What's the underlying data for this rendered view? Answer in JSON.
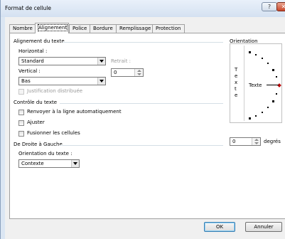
{
  "window": {
    "title": "Format de cellule",
    "help_glyph": "?",
    "close_glyph": "✕"
  },
  "tabs": [
    {
      "label": "Nombre"
    },
    {
      "label": "Alignement"
    },
    {
      "label": "Police"
    },
    {
      "label": "Bordure"
    },
    {
      "label": "Remplissage"
    },
    {
      "label": "Protection"
    }
  ],
  "active_tab": "Alignement",
  "text_alignment": {
    "group_label": "Alignement du texte",
    "horizontal_label": "Horizontal :",
    "horizontal_value": "Standard",
    "vertical_label": "Vertical :",
    "vertical_value": "Bas",
    "indent_label": "Retrait :",
    "indent_value": "0",
    "justify_distributed_label": "Justification distribuée"
  },
  "text_control": {
    "group_label": "Contrôle du texte",
    "wrap_label": "Renvoyer à la ligne automatiquement",
    "shrink_label": "Ajuster",
    "merge_label": "Fusionner les cellules"
  },
  "rtl": {
    "group_label": "De Droite à Gauche",
    "direction_label": "Orientation du texte :",
    "direction_value": "Contexte"
  },
  "orientation": {
    "group_label": "Orientation",
    "vertical_text": [
      "T",
      "e",
      "x",
      "t",
      "e"
    ],
    "dial_label": "Texte",
    "degrees_value": "0",
    "degrees_label": "degrés"
  },
  "buttons": {
    "ok": "OK",
    "cancel": "Annuler"
  },
  "colors": {
    "dialog_bg": "#f0f0f0",
    "titlebar": "#dbe6f3",
    "close_button": "#c9472b",
    "dial_marker": "#bb0000"
  }
}
